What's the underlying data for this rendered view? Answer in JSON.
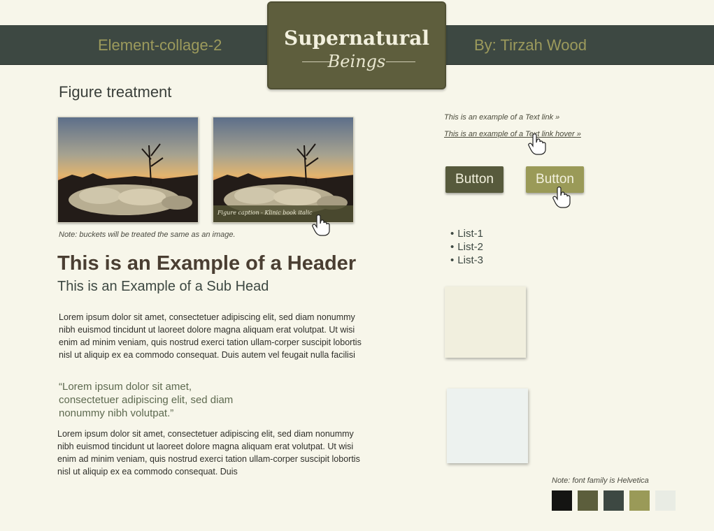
{
  "header": {
    "left_title": "Element-collage-2",
    "right_title": "By: Tirzah Wood"
  },
  "logo": {
    "line1": "Supernatural",
    "line2": "Beings"
  },
  "figure": {
    "title": "Figure treatment",
    "caption": "Figure caption - Klinic book italic",
    "note": "Note: buckets will be treated the same as an image."
  },
  "typography": {
    "header": "This is an Example of a Header",
    "subhead": "This is an Example of a Sub Head",
    "paragraph1": "Lorem ipsum dolor sit amet, consectetuer adipiscing elit, sed diam nonummy nibh euismod tincidunt ut laoreet dolore magna aliquam erat volutpat. Ut wisi enim ad minim veniam, quis nostrud exerci tation ullam-corper suscipit lobortis nisl ut aliquip ex ea commodo consequat. Duis autem vel feugait nulla facilisi",
    "quote": "“Lorem ipsum dolor sit amet, consectetuer adipiscing elit, sed diam nonummy nibh volutpat.”",
    "paragraph2": "Lorem ipsum dolor sit amet, consectetuer adipiscing elit, sed diam nonummy nibh euismod tincidunt ut laoreet dolore magna aliquam erat volutpat. Ut wisi enim ad minim veniam, quis nostrud exerci tation ullam-corper suscipit lobortis nisl ut aliquip ex ea commodo consequat. Duis"
  },
  "links": {
    "normal": "This is an example of a Text link »",
    "hover": "This is an example of a Text link hover »"
  },
  "buttons": {
    "normal": "Button",
    "hover": "Button"
  },
  "list": [
    "List-1",
    "List-2",
    "List-3"
  ],
  "palette": {
    "note": "Note: font family is Helvetica",
    "colors": [
      "#141412",
      "#5c5e3c",
      "#3d4842",
      "#9a9a58",
      "#e9ece4"
    ]
  }
}
